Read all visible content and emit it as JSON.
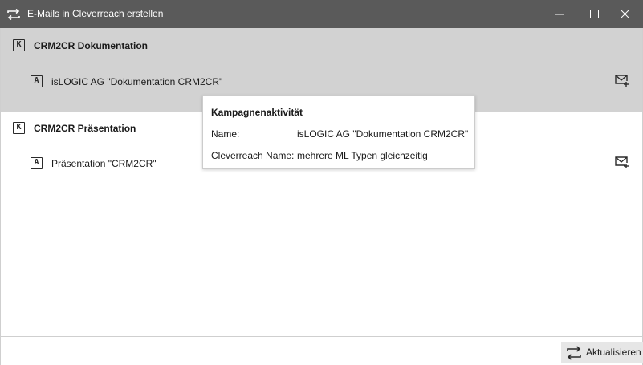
{
  "window": {
    "title": "E-Mails in Cleverreach erstellen",
    "app_icon": "swap-arrows-icon",
    "controls": [
      "minimize-icon",
      "maximize-icon",
      "close-icon"
    ]
  },
  "campaigns": [
    {
      "badge": "K",
      "title": "CRM2CR Dokumentation",
      "selected": true,
      "activity": {
        "badge": "A",
        "label": "isLOGIC AG \"Dokumentation CRM2CR\"",
        "action_icon": "mail-add-icon"
      }
    },
    {
      "badge": "K",
      "title": "CRM2CR Präsentation",
      "selected": false,
      "activity": {
        "badge": "A",
        "label": "Präsentation \"CRM2CR\"",
        "action_icon": "mail-add-icon"
      }
    }
  ],
  "tooltip": {
    "heading": "Kampagnenaktivität",
    "rows": [
      {
        "label": "Name:",
        "value": "isLOGIC AG \"Dokumentation CRM2CR\""
      },
      {
        "label": "Cleverreach Name:",
        "value": "mehrere ML Typen gleichzeitig"
      }
    ]
  },
  "footer": {
    "refresh_label": "Aktualisieren",
    "refresh_icon": "refresh-swap-icon"
  },
  "colors": {
    "titlebar": "#5a5a5a",
    "selected_row": "#d2d2d2",
    "button_bg": "#e6e6e6"
  }
}
